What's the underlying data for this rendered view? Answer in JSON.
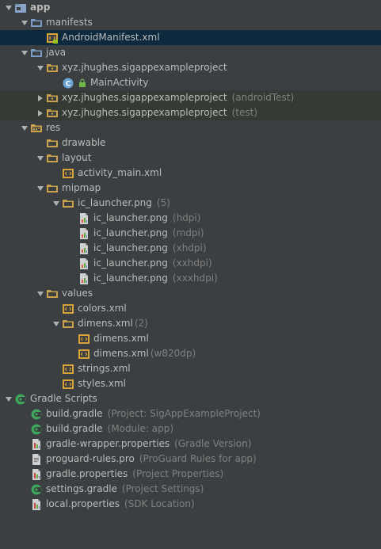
{
  "tree": [
    {
      "label": "app",
      "hint": "",
      "icon": "app-module-icon",
      "arrow": "down",
      "depth": 0,
      "bold": true
    },
    {
      "label": "manifests",
      "hint": "",
      "icon": "folder-blue-icon",
      "arrow": "down",
      "depth": 1
    },
    {
      "label": "AndroidManifest.xml",
      "hint": "",
      "icon": "xml-manifest-icon",
      "arrow": "",
      "depth": 2,
      "selected": true
    },
    {
      "label": "java",
      "hint": "",
      "icon": "folder-blue-icon",
      "arrow": "down",
      "depth": 1
    },
    {
      "label": "xyz.jhughes.sigappexampleproject",
      "hint": "",
      "icon": "package-icon",
      "arrow": "down",
      "depth": 2
    },
    {
      "label": "MainActivity",
      "hint": "",
      "icon": "class-icon",
      "arrow": "",
      "depth": 3,
      "lock": true
    },
    {
      "label": "xyz.jhughes.sigappexampleproject",
      "hint": "(androidTest)",
      "icon": "package-icon",
      "arrow": "right",
      "depth": 2,
      "highlight": true
    },
    {
      "label": "xyz.jhughes.sigappexampleproject",
      "hint": "(test)",
      "icon": "package-icon",
      "arrow": "right",
      "depth": 2,
      "highlight": true
    },
    {
      "label": "res",
      "hint": "",
      "icon": "res-folder-icon",
      "arrow": "down",
      "depth": 1
    },
    {
      "label": "drawable",
      "hint": "",
      "icon": "folder-icon",
      "arrow": "",
      "depth": 2
    },
    {
      "label": "layout",
      "hint": "",
      "icon": "folder-icon",
      "arrow": "down",
      "depth": 2
    },
    {
      "label": "activity_main.xml",
      "hint": "",
      "icon": "xml-file-icon",
      "arrow": "",
      "depth": 3
    },
    {
      "label": "mipmap",
      "hint": "",
      "icon": "folder-icon",
      "arrow": "down",
      "depth": 2
    },
    {
      "label": "ic_launcher.png",
      "hint": "(5)",
      "icon": "folder-icon",
      "arrow": "down",
      "depth": 3
    },
    {
      "label": "ic_launcher.png",
      "hint": "(hdpi)",
      "icon": "image-file-icon",
      "arrow": "",
      "depth": 4
    },
    {
      "label": "ic_launcher.png",
      "hint": "(mdpi)",
      "icon": "image-file-icon",
      "arrow": "",
      "depth": 4
    },
    {
      "label": "ic_launcher.png",
      "hint": "(xhdpi)",
      "icon": "image-file-icon",
      "arrow": "",
      "depth": 4
    },
    {
      "label": "ic_launcher.png",
      "hint": "(xxhdpi)",
      "icon": "image-file-icon",
      "arrow": "",
      "depth": 4
    },
    {
      "label": "ic_launcher.png",
      "hint": "(xxxhdpi)",
      "icon": "image-file-icon",
      "arrow": "",
      "depth": 4
    },
    {
      "label": "values",
      "hint": "",
      "icon": "folder-icon",
      "arrow": "down",
      "depth": 2
    },
    {
      "label": "colors.xml",
      "hint": "",
      "icon": "xml-file-icon",
      "arrow": "",
      "depth": 3
    },
    {
      "label": "dimens.xml",
      "hint": "(2)",
      "icon": "folder-icon",
      "arrow": "down",
      "depth": 3,
      "tight": true
    },
    {
      "label": "dimens.xml",
      "hint": "",
      "icon": "xml-file-icon",
      "arrow": "",
      "depth": 4
    },
    {
      "label": "dimens.xml",
      "hint": "(w820dp)",
      "icon": "xml-file-icon",
      "arrow": "",
      "depth": 4,
      "tight": true
    },
    {
      "label": "strings.xml",
      "hint": "",
      "icon": "xml-file-icon",
      "arrow": "",
      "depth": 3
    },
    {
      "label": "styles.xml",
      "hint": "",
      "icon": "xml-file-icon",
      "arrow": "",
      "depth": 3
    },
    {
      "label": "Gradle Scripts",
      "hint": "",
      "icon": "gradle-icon",
      "arrow": "down",
      "depth": 0
    },
    {
      "label": "build.gradle",
      "hint": "(Project: SigAppExampleProject)",
      "icon": "gradle-icon",
      "arrow": "",
      "depth": 1
    },
    {
      "label": "build.gradle",
      "hint": "(Module: app)",
      "icon": "gradle-icon",
      "arrow": "",
      "depth": 1
    },
    {
      "label": "gradle-wrapper.properties",
      "hint": "(Gradle Version)",
      "icon": "properties-file-icon",
      "arrow": "",
      "depth": 1
    },
    {
      "label": "proguard-rules.pro",
      "hint": "(ProGuard Rules for app)",
      "icon": "text-file-icon",
      "arrow": "",
      "depth": 1
    },
    {
      "label": "gradle.properties",
      "hint": "(Project Properties)",
      "icon": "properties-file-icon",
      "arrow": "",
      "depth": 1
    },
    {
      "label": "settings.gradle",
      "hint": "(Project Settings)",
      "icon": "gradle-icon",
      "arrow": "",
      "depth": 1
    },
    {
      "label": "local.properties",
      "hint": "(SDK Location)",
      "icon": "properties-file-icon",
      "arrow": "",
      "depth": 1
    }
  ],
  "colors": {
    "background": "#3c3f41",
    "selected": "#0d293e",
    "test_highlight": "#353a34",
    "text": "#bbbbbb",
    "hint": "#808080"
  }
}
